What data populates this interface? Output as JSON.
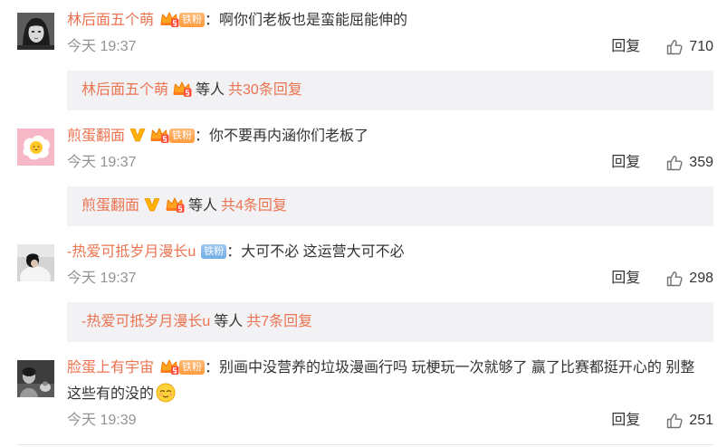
{
  "colors": {
    "username": "#eb7350",
    "text": "#333333",
    "time": "#939393",
    "reply_box_bg": "#f2f2f5"
  },
  "icons": {
    "like": "thumbs-up-icon",
    "fan_club": "crown-icon",
    "verified": "yellow-v-icon",
    "emoji": "smirk-emoji-icon"
  },
  "comments": [
    {
      "username": "林后面五个萌",
      "badges": [
        "crown-icon"
      ],
      "fan_badge": "铁粉",
      "fan_badge_color": "#ff9b3d",
      "content": "：啊你们老板也是蛮能屈能伸的",
      "time": "今天 19:37",
      "reply_label": "回复",
      "likes": "710",
      "reply_summary": {
        "username": "林后面五个萌",
        "badges": [
          "crown-icon"
        ],
        "others": "等人",
        "count": "共30条回复"
      }
    },
    {
      "username": "煎蛋翻面",
      "badges": [
        "yellow-v-icon",
        "crown-icon"
      ],
      "fan_badge": "铁粉",
      "fan_badge_color": "#ff9b3d",
      "content": "：你不要再内涵你们老板了",
      "time": "今天 19:37",
      "reply_label": "回复",
      "likes": "359",
      "reply_summary": {
        "username": "煎蛋翻面",
        "badges": [
          "yellow-v-icon",
          "crown-icon"
        ],
        "others": "等人",
        "count": "共4条回复"
      }
    },
    {
      "username": "-热爱可抵岁月漫长u",
      "badges": [],
      "fan_badge": "铁粉",
      "fan_badge_color": "#72aee6",
      "content": "：大可不必 这运营大可不必",
      "time": "今天 19:37",
      "reply_label": "回复",
      "likes": "298",
      "reply_summary": {
        "username": "-热爱可抵岁月漫长u",
        "badges": [],
        "others": "等人",
        "count": "共7条回复"
      }
    },
    {
      "username": "脸蛋上有宇宙",
      "badges": [
        "crown-icon"
      ],
      "fan_badge": "铁粉",
      "fan_badge_color": "#ff9b3d",
      "content": "：别画中没营养的垃圾漫画行吗 玩梗玩一次就够了 赢了比赛都挺开心的 别整这些有的没的",
      "content_emoji": "smirk-emoji-icon",
      "time": "今天 19:39",
      "reply_label": "回复",
      "likes": "251"
    }
  ]
}
